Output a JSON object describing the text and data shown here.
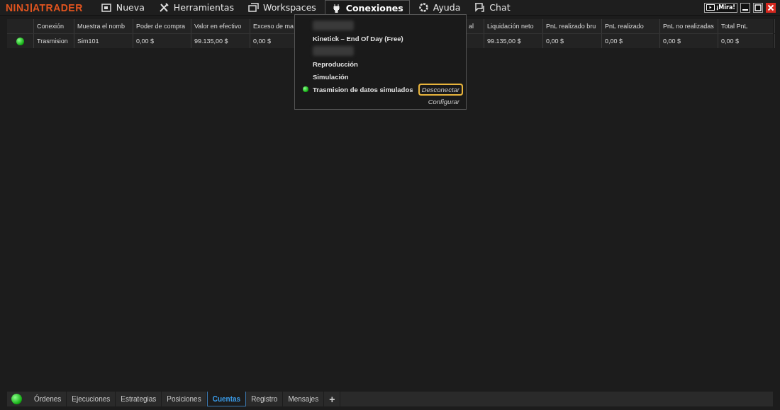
{
  "app": {
    "logo_left": "NINJ",
    "logo_right": "ATRADER"
  },
  "menu": [
    {
      "label": "Nueva",
      "selected": false
    },
    {
      "label": "Herramientas",
      "selected": false
    },
    {
      "label": "Workspaces",
      "selected": false
    },
    {
      "label": "Conexiones",
      "selected": true
    },
    {
      "label": "Ayuda",
      "selected": false
    },
    {
      "label": "Chat",
      "selected": false
    }
  ],
  "window_controls": {
    "watch_label": "¡Mira!"
  },
  "table": {
    "columns": [
      "",
      "Conexión",
      "Muestra el nomb",
      "Poder de compra",
      "Valor en efectivo",
      "Exceso de ma",
      "",
      "al",
      "Liquidación neto",
      "PnL realizado bru",
      "PnL realizado",
      "PnL no realizadas",
      "Total PnL"
    ],
    "rows": [
      {
        "connected": true,
        "cells": [
          "",
          "Trasmision",
          "Sim101",
          "0,00 $",
          "99.135,00 $",
          "0,00 $",
          "",
          "",
          "99.135,00 $",
          "0,00 $",
          "0,00 $",
          "0,00 $",
          "0,00 $"
        ]
      }
    ]
  },
  "connections_menu": {
    "items": [
      {
        "kind": "redacted"
      },
      {
        "kind": "connection",
        "label": "Kinetick – End Of Day (Free)",
        "connected": false
      },
      {
        "kind": "redacted"
      },
      {
        "kind": "connection",
        "label": "Reproducción",
        "connected": false
      },
      {
        "kind": "connection",
        "label": "Simulación",
        "connected": false
      },
      {
        "kind": "connection",
        "label": "Trasmision de datos simulados",
        "connected": true,
        "action": "Desconectar",
        "highlighted": true
      }
    ],
    "configure": "Configurar"
  },
  "bottom_tabs": {
    "connected": true,
    "tabs": [
      {
        "label": "Órdenes",
        "selected": false
      },
      {
        "label": "Ejecuciones",
        "selected": false
      },
      {
        "label": "Estrategias",
        "selected": false
      },
      {
        "label": "Posiciones",
        "selected": false
      },
      {
        "label": "Cuentas",
        "selected": true
      },
      {
        "label": "Registro",
        "selected": false
      },
      {
        "label": "Mensajes",
        "selected": false
      }
    ],
    "add": "+"
  }
}
